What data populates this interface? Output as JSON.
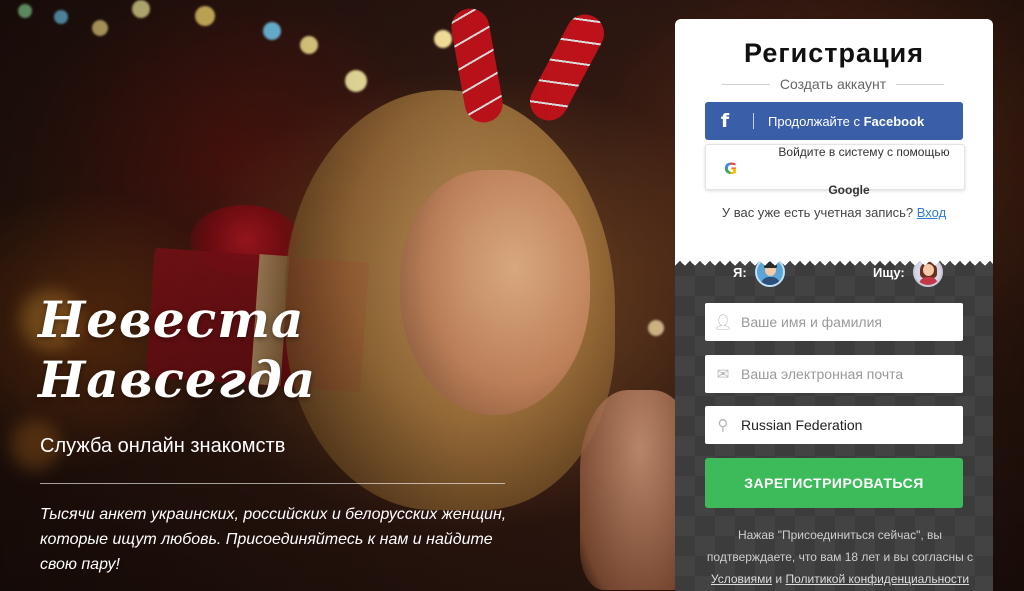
{
  "hero": {
    "title_line1": "Невеста",
    "title_line2": "Навсегда",
    "subtitle": "Служба онлайн знакомств",
    "description": "Тысячи анкет украинских, российских и белорусских женщин, которые ищут любовь. Присоединяйтесь к нам и найдите свою пару!"
  },
  "registration": {
    "title": "Регистрация",
    "subtitle": "Создать аккаунт",
    "facebook_icon": "f",
    "facebook_label_prefix": "Продолжайте с ",
    "facebook_label_brand": "Facebook",
    "google_icon": "G",
    "google_label_line1": "Войдите в систему с помощью",
    "google_label_line2": "Google",
    "have_account_text": "У вас уже есть учетная запись? ",
    "login_link": "Вход"
  },
  "gender": {
    "me_label": "Я:",
    "seek_label": "Ищу:",
    "me_icon": "male-avatar-icon",
    "seek_icon": "female-avatar-icon"
  },
  "form": {
    "name_placeholder": "Ваше имя и фамилия",
    "email_placeholder": "Ваша электронная почта",
    "country_value": "Russian Federation",
    "submit_label": "ЗАРЕГИСТРИРОВАТЬСЯ"
  },
  "terms": {
    "text_before": "Нажав \"Присоединиться сейчас\", вы подтверждаете, что вам 18 лет и вы согласны с ",
    "terms_link": "Условиями",
    "and_text": " и ",
    "privacy_link": "Политикой конфиденциальности"
  },
  "colors": {
    "facebook": "#3b5ea8",
    "register_button": "#3dbb5a",
    "link": "#2e7bcf",
    "panel_dark": "#3c3c3c"
  }
}
